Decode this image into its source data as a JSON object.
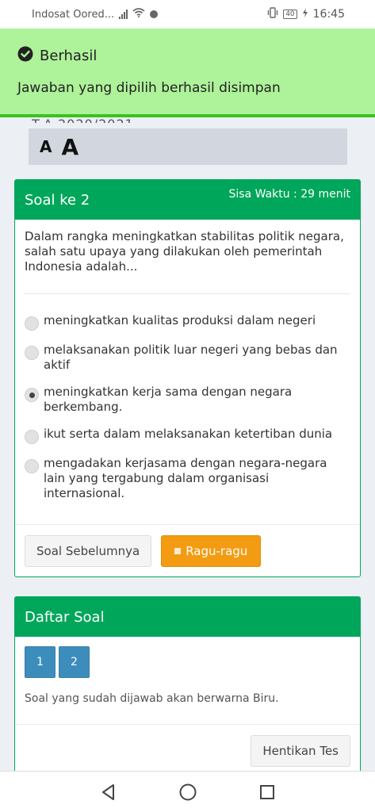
{
  "status_bar": {
    "carrier": "Indosat Oored...",
    "battery": "40",
    "time": "16:45"
  },
  "toast": {
    "title": "Berhasil",
    "message": "Jawaban yang dipilih berhasil disimpan",
    "partial_text": "T.A 2020/2021"
  },
  "font_controls": {
    "small": "A",
    "large": "A"
  },
  "question_card": {
    "title": "Soal ke 2",
    "timer": "Sisa Waktu : 29 menit",
    "question": "Dalam rangka meningkatkan stabilitas politik negara, salah satu upaya yang dilakukan oleh pemerintah Indonesia adalah...",
    "options": [
      {
        "text": "meningkatkan kualitas produksi dalam negeri",
        "selected": false
      },
      {
        "text": "melaksanakan politik luar negeri yang bebas dan aktif",
        "selected": false
      },
      {
        "text": "meningkatkan kerja sama dengan negara berkembang.",
        "selected": true
      },
      {
        "text": "ikut serta dalam melaksanakan ketertiban dunia",
        "selected": false
      },
      {
        "text": "mengadakan kerjasama dengan negara-negara lain yang tergabung dalam organisasi internasional.",
        "selected": false
      }
    ],
    "prev_button": "Soal Sebelumnya",
    "doubt_button": "Ragu-ragu"
  },
  "question_list": {
    "title": "Daftar Soal",
    "numbers": [
      "1",
      "2"
    ],
    "hint": "Soal yang sudah dijawab akan berwarna Biru.",
    "stop_button": "Hentikan Tes"
  },
  "colors": {
    "header_green": "#00a65a",
    "toast_bg": "#aef29a",
    "number_blue": "#3c8dbc",
    "doubt_orange": "#f39c12"
  },
  "icons": [
    "signal-icon",
    "wifi-icon",
    "notification-dot-icon",
    "vibrate-icon",
    "battery-icon",
    "charging-icon",
    "check-circle-icon",
    "back-icon",
    "home-icon",
    "recents-icon"
  ]
}
